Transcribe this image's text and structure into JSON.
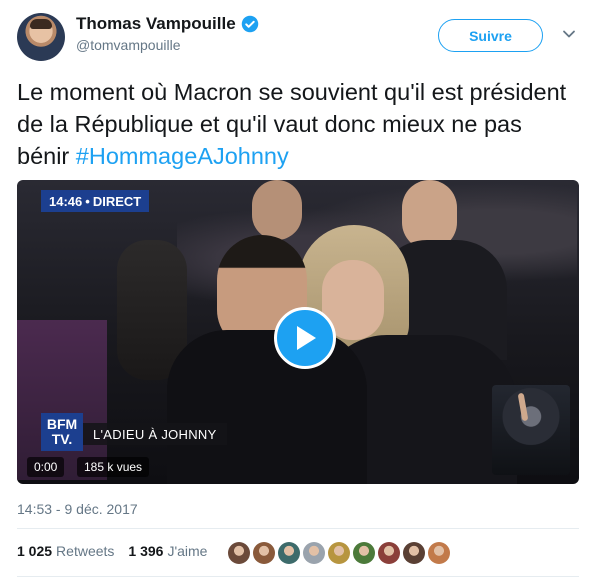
{
  "author": {
    "name": "Thomas Vampouille",
    "handle": "@tomvampouille",
    "verified": true
  },
  "follow_button": {
    "label": "Suivre"
  },
  "tweet": {
    "text": "Le moment où Macron se souvient qu'il est président de la République et qu'il vaut donc mieux ne pas bénir ",
    "hashtag": "#HommageAJohnny"
  },
  "video": {
    "live_time": "14:46",
    "live_label": "DIRECT",
    "channel_logo_line1": "BFM",
    "channel_logo_line2": "TV.",
    "banner": "L'ADIEU À JOHNNY",
    "elapsed": "0:00",
    "views": "185 k vues"
  },
  "timestamp": "14:53 - 9 déc. 2017",
  "stats": {
    "retweets_count": "1 025",
    "retweets_label": "Retweets",
    "likes_count": "1 396",
    "likes_label": "J'aime"
  },
  "likers": [
    {
      "name": "liker-1",
      "color": "#6b4a3a"
    },
    {
      "name": "liker-2",
      "color": "#8a5a3b"
    },
    {
      "name": "liker-3",
      "color": "#3d6b6b"
    },
    {
      "name": "liker-4",
      "color": "#9aa3ad"
    },
    {
      "name": "liker-5",
      "color": "#b7953f"
    },
    {
      "name": "liker-6",
      "color": "#4c7a3a"
    },
    {
      "name": "liker-7",
      "color": "#8b3f3a"
    },
    {
      "name": "liker-8",
      "color": "#5a4034"
    },
    {
      "name": "liker-9",
      "color": "#c27a4a"
    }
  ],
  "colors": {
    "accent": "#1da1f2",
    "secondary_text": "#657786",
    "channel_blue": "#1c3f8f"
  }
}
